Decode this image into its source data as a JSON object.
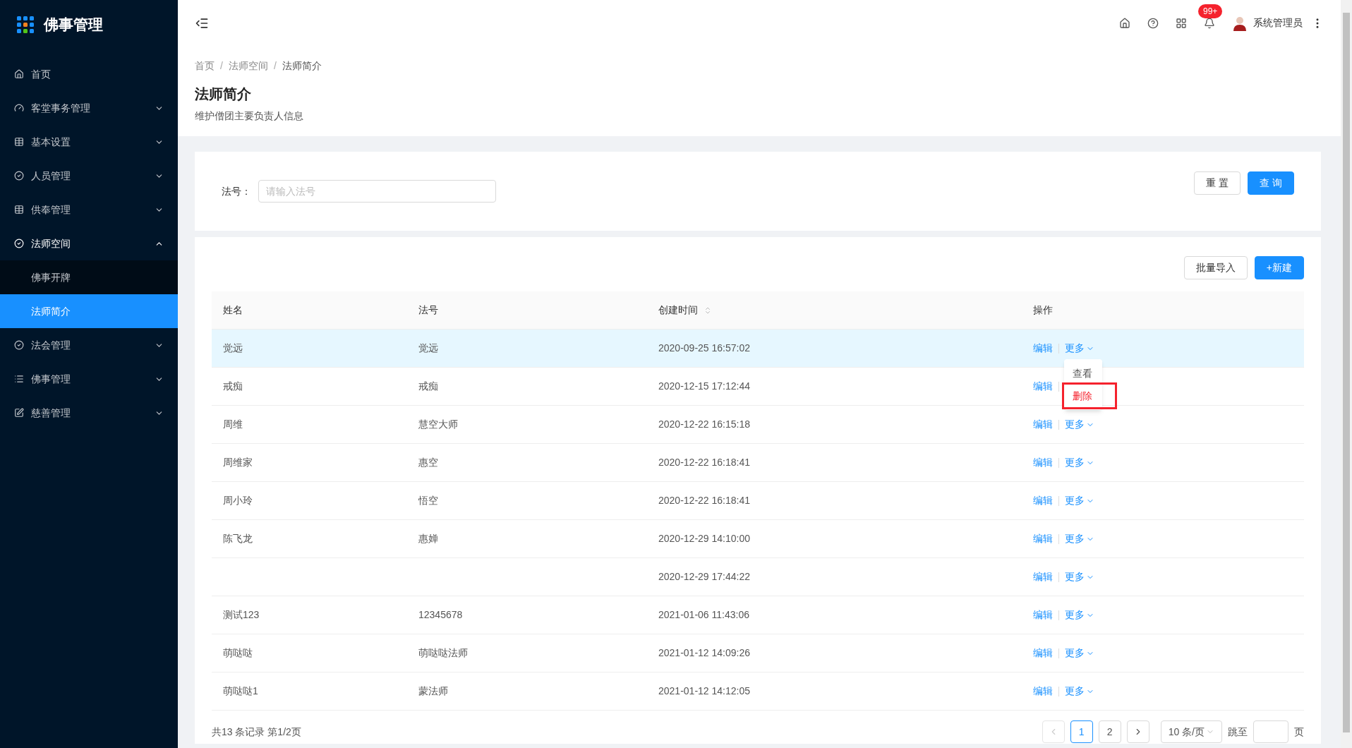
{
  "app": {
    "title": "佛事管理"
  },
  "sidebar": {
    "items": [
      {
        "label": "首页",
        "expandable": false,
        "expanded": false
      },
      {
        "label": "客堂事务管理",
        "expandable": true,
        "expanded": false
      },
      {
        "label": "基本设置",
        "expandable": true,
        "expanded": false
      },
      {
        "label": "人员管理",
        "expandable": true,
        "expanded": false
      },
      {
        "label": "供奉管理",
        "expandable": true,
        "expanded": false
      },
      {
        "label": "法师空间",
        "expandable": true,
        "expanded": true,
        "children": [
          {
            "label": "佛事开牌",
            "selected": false
          },
          {
            "label": "法师简介",
            "selected": true
          }
        ]
      },
      {
        "label": "法会管理",
        "expandable": true,
        "expanded": false
      },
      {
        "label": "佛事管理",
        "expandable": true,
        "expanded": false
      },
      {
        "label": "慈善管理",
        "expandable": true,
        "expanded": false
      }
    ]
  },
  "header": {
    "notification_badge": "99+",
    "user": "系统管理员"
  },
  "breadcrumb": [
    {
      "label": "首页"
    },
    {
      "separator": "/",
      "label": "法师空间"
    },
    {
      "separator": "/",
      "label": "法师简介"
    }
  ],
  "page": {
    "title": "法师简介",
    "subtitle": "维护僧团主要负责人信息"
  },
  "search": {
    "label": "法号：",
    "placeholder": "请输入法号",
    "buttons": [
      {
        "label": "重 置",
        "primary": false
      },
      {
        "label": "查 询",
        "primary": true
      }
    ]
  },
  "toolbar": {
    "buttons": [
      {
        "label": "批量导入",
        "primary": false
      },
      {
        "label": "+新建",
        "primary": true
      }
    ]
  },
  "table": {
    "columns": [
      "姓名",
      "法号",
      "创建时间",
      "操作"
    ],
    "rows": [
      {
        "name": "觉远",
        "dharma_name": "觉远",
        "created": "2020-09-25 16:57:02",
        "highlighted": true,
        "edit": "编辑",
        "more": "更多",
        "menu": [
          {
            "label": "查看",
            "kind": "normal",
            "outlined": false
          },
          {
            "label": "删除",
            "kind": "danger",
            "outlined": true
          }
        ]
      },
      {
        "name": "戒痴",
        "dharma_name": "戒痴",
        "created": "2020-12-15 17:12:44",
        "highlighted": false,
        "edit": "编辑"
      },
      {
        "name": "周维",
        "dharma_name": "慧空大师",
        "created": "2020-12-22 16:15:18",
        "highlighted": false,
        "edit": "编辑",
        "more": "更多"
      },
      {
        "name": "周维家",
        "dharma_name": "惠空",
        "created": "2020-12-22 16:18:41",
        "highlighted": false,
        "edit": "编辑",
        "more": "更多"
      },
      {
        "name": "周小玲",
        "dharma_name": "悟空",
        "created": "2020-12-22 16:18:41",
        "highlighted": false,
        "edit": "编辑",
        "more": "更多"
      },
      {
        "name": "陈飞龙",
        "dharma_name": "惠婵",
        "created": "2020-12-29 14:10:00",
        "highlighted": false,
        "edit": "编辑",
        "more": "更多"
      },
      {
        "created": "2020-12-29 17:44:22",
        "highlighted": false,
        "edit": "编辑",
        "more": "更多"
      },
      {
        "name": "测试123",
        "dharma_name": "12345678",
        "created": "2021-01-06 11:43:06",
        "highlighted": false,
        "edit": "编辑",
        "more": "更多"
      },
      {
        "name": "萌哒哒",
        "dharma_name": "萌哒哒法师",
        "created": "2021-01-12 14:09:26",
        "highlighted": false,
        "edit": "编辑",
        "more": "更多"
      },
      {
        "name": "萌哒哒1",
        "dharma_name": "蒙法师",
        "created": "2021-01-12 14:12:05",
        "highlighted": false,
        "edit": "编辑",
        "more": "更多"
      }
    ]
  },
  "pagination": {
    "summary": "共13 条记录 第1/2页",
    "pages": [
      {
        "label": "1",
        "selected": true
      },
      {
        "label": "2",
        "selected": false
      }
    ],
    "page_size": "10 条/页",
    "jump_label": "跳至",
    "page_suffix": "页"
  }
}
